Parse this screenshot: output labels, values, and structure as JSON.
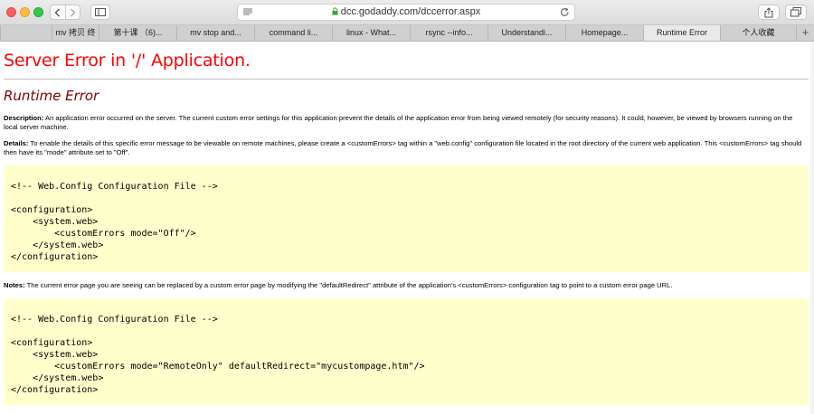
{
  "browser": {
    "url": "dcc.godaddy.com/dccerror.aspx",
    "tabs": [
      {
        "label": "",
        "active": false
      },
      {
        "label": "mv 拷贝 终",
        "active": false
      },
      {
        "label": "第十课 （6)...",
        "active": false
      },
      {
        "label": "mv stop and...",
        "active": false
      },
      {
        "label": "command li...",
        "active": false
      },
      {
        "label": "linux - What...",
        "active": false
      },
      {
        "label": "rsync --info...",
        "active": false
      },
      {
        "label": "Understandi...",
        "active": false
      },
      {
        "label": "Homepage...",
        "active": false
      },
      {
        "label": "Runtime Error",
        "active": true
      },
      {
        "label": "个人收藏",
        "active": false
      }
    ],
    "new_tab_label": "+"
  },
  "page": {
    "title": "Server Error in '/' Application.",
    "subtitle": "Runtime Error",
    "description_label": "Description:",
    "description_text": " An application error occurred on the server. The current custom error settings for this application prevent the details of the application error from being viewed remotely (for security reasons). It could, however, be viewed by browsers running on the local server machine.",
    "details_label": "Details:",
    "details_text": " To enable the details of this specific error message to be viewable on remote machines, please create a <customErrors> tag within a \"web.config\" configuration file located in the root directory of the current web application. This <customErrors> tag should then have its \"mode\" attribute set to \"Off\".",
    "code1": [
      "<!-- Web.Config Configuration File -->",
      "",
      "<configuration>",
      "    <system.web>",
      "        <customErrors mode=\"Off\"/>",
      "    </system.web>",
      "</configuration>"
    ],
    "notes_label": "Notes:",
    "notes_text": " The current error page you are seeing can be replaced by a custom error page by modifying the \"defaultRedirect\" attribute of the application's <customErrors> configuration tag to point to a custom error page URL.",
    "code2": [
      "<!-- Web.Config Configuration File -->",
      "",
      "<configuration>",
      "    <system.web>",
      "        <customErrors mode=\"RemoteOnly\" defaultRedirect=\"mycustompage.htm\"/>",
      "    </system.web>",
      "</configuration>"
    ]
  }
}
